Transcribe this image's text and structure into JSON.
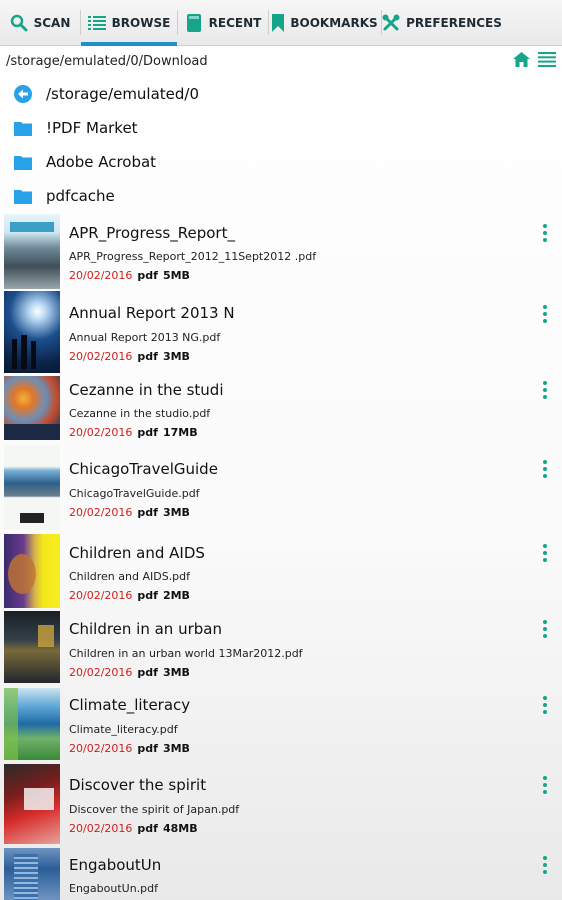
{
  "colors": {
    "accent": "#1e8fc9",
    "teal": "#17a589",
    "date_red": "#d21e1e",
    "folder_blue": "#27a2e8"
  },
  "tabs": [
    {
      "label": "SCAN",
      "icon": "search-icon"
    },
    {
      "label": "BROWSE",
      "icon": "list-icon",
      "active": true
    },
    {
      "label": "RECENT",
      "icon": "book-icon"
    },
    {
      "label": "BOOKMARKS",
      "icon": "bookmark-icon"
    },
    {
      "label": "PREFERENCES",
      "icon": "tools-icon"
    }
  ],
  "path": {
    "current": "/storage/emulated/0/Download"
  },
  "folders": [
    {
      "label": "/storage/emulated/0",
      "icon": "back-arrow-icon"
    },
    {
      "label": "!PDF Market",
      "icon": "folder-icon"
    },
    {
      "label": "Adobe Acrobat",
      "icon": "folder-icon"
    },
    {
      "label": "pdfcache",
      "icon": "folder-icon"
    }
  ],
  "files": [
    {
      "title": "APR_Progress_Report_",
      "filename": "APR_Progress_Report_2012_11Sept2012 .pdf",
      "date": "20/02/2016",
      "type": "pdf",
      "size": "5MB"
    },
    {
      "title": "Annual Report 2013 N",
      "filename": "Annual Report 2013 NG.pdf",
      "date": "20/02/2016",
      "type": "pdf",
      "size": "3MB"
    },
    {
      "title": "Cezanne in the studi",
      "filename": "Cezanne in the studio.pdf",
      "date": "20/02/2016",
      "type": "pdf",
      "size": "17MB"
    },
    {
      "title": "ChicagoTravelGuide",
      "filename": "ChicagoTravelGuide.pdf",
      "date": "20/02/2016",
      "type": "pdf",
      "size": "3MB"
    },
    {
      "title": "Children and AIDS",
      "filename": "Children and AIDS.pdf",
      "date": "20/02/2016",
      "type": "pdf",
      "size": "2MB"
    },
    {
      "title": "Children in an urban",
      "filename": "Children in an urban world 13Mar2012.pdf",
      "date": "20/02/2016",
      "type": "pdf",
      "size": "3MB"
    },
    {
      "title": "Climate_literacy",
      "filename": "Climate_literacy.pdf",
      "date": "20/02/2016",
      "type": "pdf",
      "size": "3MB"
    },
    {
      "title": "Discover the spirit",
      "filename": "Discover the spirit of Japan.pdf",
      "date": "20/02/2016",
      "type": "pdf",
      "size": "48MB"
    },
    {
      "title": "EngaboutUn",
      "filename": "EngaboutUn.pdf"
    }
  ]
}
